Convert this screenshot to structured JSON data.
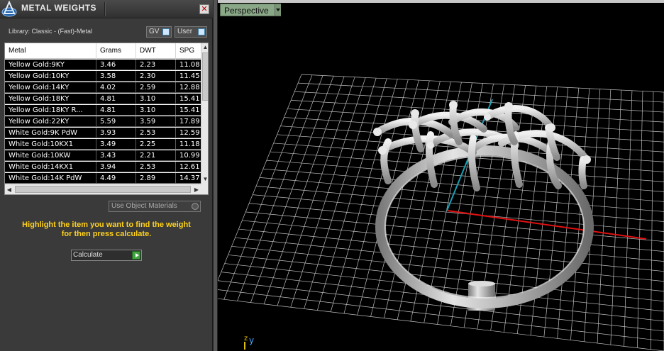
{
  "panel": {
    "title": "METAL WEIGHTS",
    "close_glyph": "✕",
    "library_label": "Library: Classic - (Fast)-Metal",
    "gv_label": "GV",
    "user_label": "User",
    "use_object_materials_label": "Use Object Materials",
    "instructions_line1": "Highlight the item you want to find the weight",
    "instructions_line2": "for then press calculate.",
    "calculate_label": "Calculate",
    "accent_color": "#ffd21a",
    "calculate_go_color": "#3fa33f"
  },
  "table": {
    "headers": [
      "Metal",
      "Grams",
      "DWT",
      "SPG"
    ],
    "rows": [
      [
        "Yellow Gold:9KY",
        "3.46",
        "2.23",
        "11.08"
      ],
      [
        "Yellow Gold:10KY",
        "3.58",
        "2.30",
        "11.45"
      ],
      [
        "Yellow Gold:14KY",
        "4.02",
        "2.59",
        "12.88"
      ],
      [
        "Yellow Gold:18KY",
        "4.81",
        "3.10",
        "15.41"
      ],
      [
        "Yellow Gold:18KY R...",
        "4.81",
        "3.10",
        "15.41"
      ],
      [
        "Yellow Gold:22KY",
        "5.59",
        "3.59",
        "17.89"
      ],
      [
        "White Gold:9K PdW",
        "3.93",
        "2.53",
        "12.59"
      ],
      [
        "White Gold:10KX1",
        "3.49",
        "2.25",
        "11.18"
      ],
      [
        "White Gold:10KW",
        "3.43",
        "2.21",
        "10.99"
      ],
      [
        "White Gold:14KX1",
        "3.94",
        "2.53",
        "12.61"
      ],
      [
        "White Gold:14K PdW",
        "4.49",
        "2.89",
        "14.37"
      ]
    ]
  },
  "viewport": {
    "view_name": "Perspective",
    "axis_z_label": "z",
    "axis_y_label": "y",
    "grid_color": "#bdbdbd",
    "x_axis_color": "#e01010",
    "y_axis_color": "#19a0b5"
  }
}
